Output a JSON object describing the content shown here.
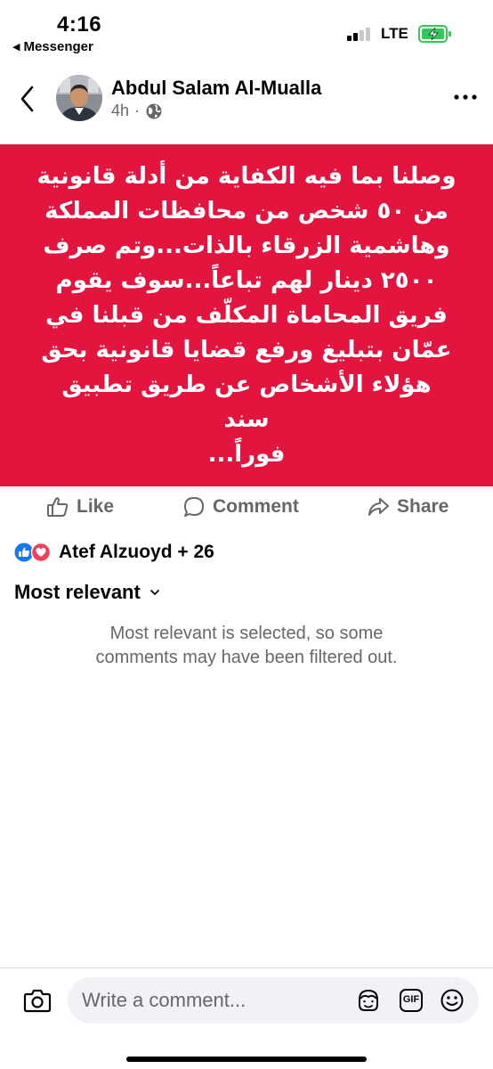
{
  "status_bar": {
    "time": "4:16",
    "back_app": "Messenger",
    "network": "LTE"
  },
  "post": {
    "author": "Abdul Salam Al-Mualla",
    "time": "4h",
    "audience_icon": "globe-icon",
    "background_color": "#e3153e",
    "text_lines": [
      "وصلنا بما فيه الكفاية من أدلة قانونية",
      "من ٥٠ شخص من محافظات المملكة",
      "وهاشمية الزرقاء بالذات...وتم صرف",
      "٢٥٠٠ دينار لهم تباعاً...سوف يقوم",
      "فريق المحاماة المكلّف من قبلنا في",
      "عمّان بتبليغ ورفع قضايا قانونية بحق",
      "هؤلاء الأشخاص عن طريق تطبيق سند",
      "فوراً..."
    ]
  },
  "actions": {
    "like": "Like",
    "comment": "Comment",
    "share": "Share"
  },
  "reactions": {
    "icons": [
      "like-reaction-icon",
      "love-reaction-icon"
    ],
    "summary": "Atef Alzuoyd + 26"
  },
  "comments": {
    "sort_label": "Most relevant",
    "filter_note_line1": "Most relevant is selected, so some",
    "filter_note_line2": "comments may have been filtered out."
  },
  "composer": {
    "placeholder": "Write a comment...",
    "icons": [
      "camera-icon",
      "avatar-sticker-icon",
      "gif-icon",
      "emoji-icon"
    ],
    "gif_label": "GIF"
  },
  "colors": {
    "accent_blue": "#1877f2",
    "love_red": "#f33e58",
    "battery_green": "#34c759",
    "secondary_text": "#65676b"
  }
}
